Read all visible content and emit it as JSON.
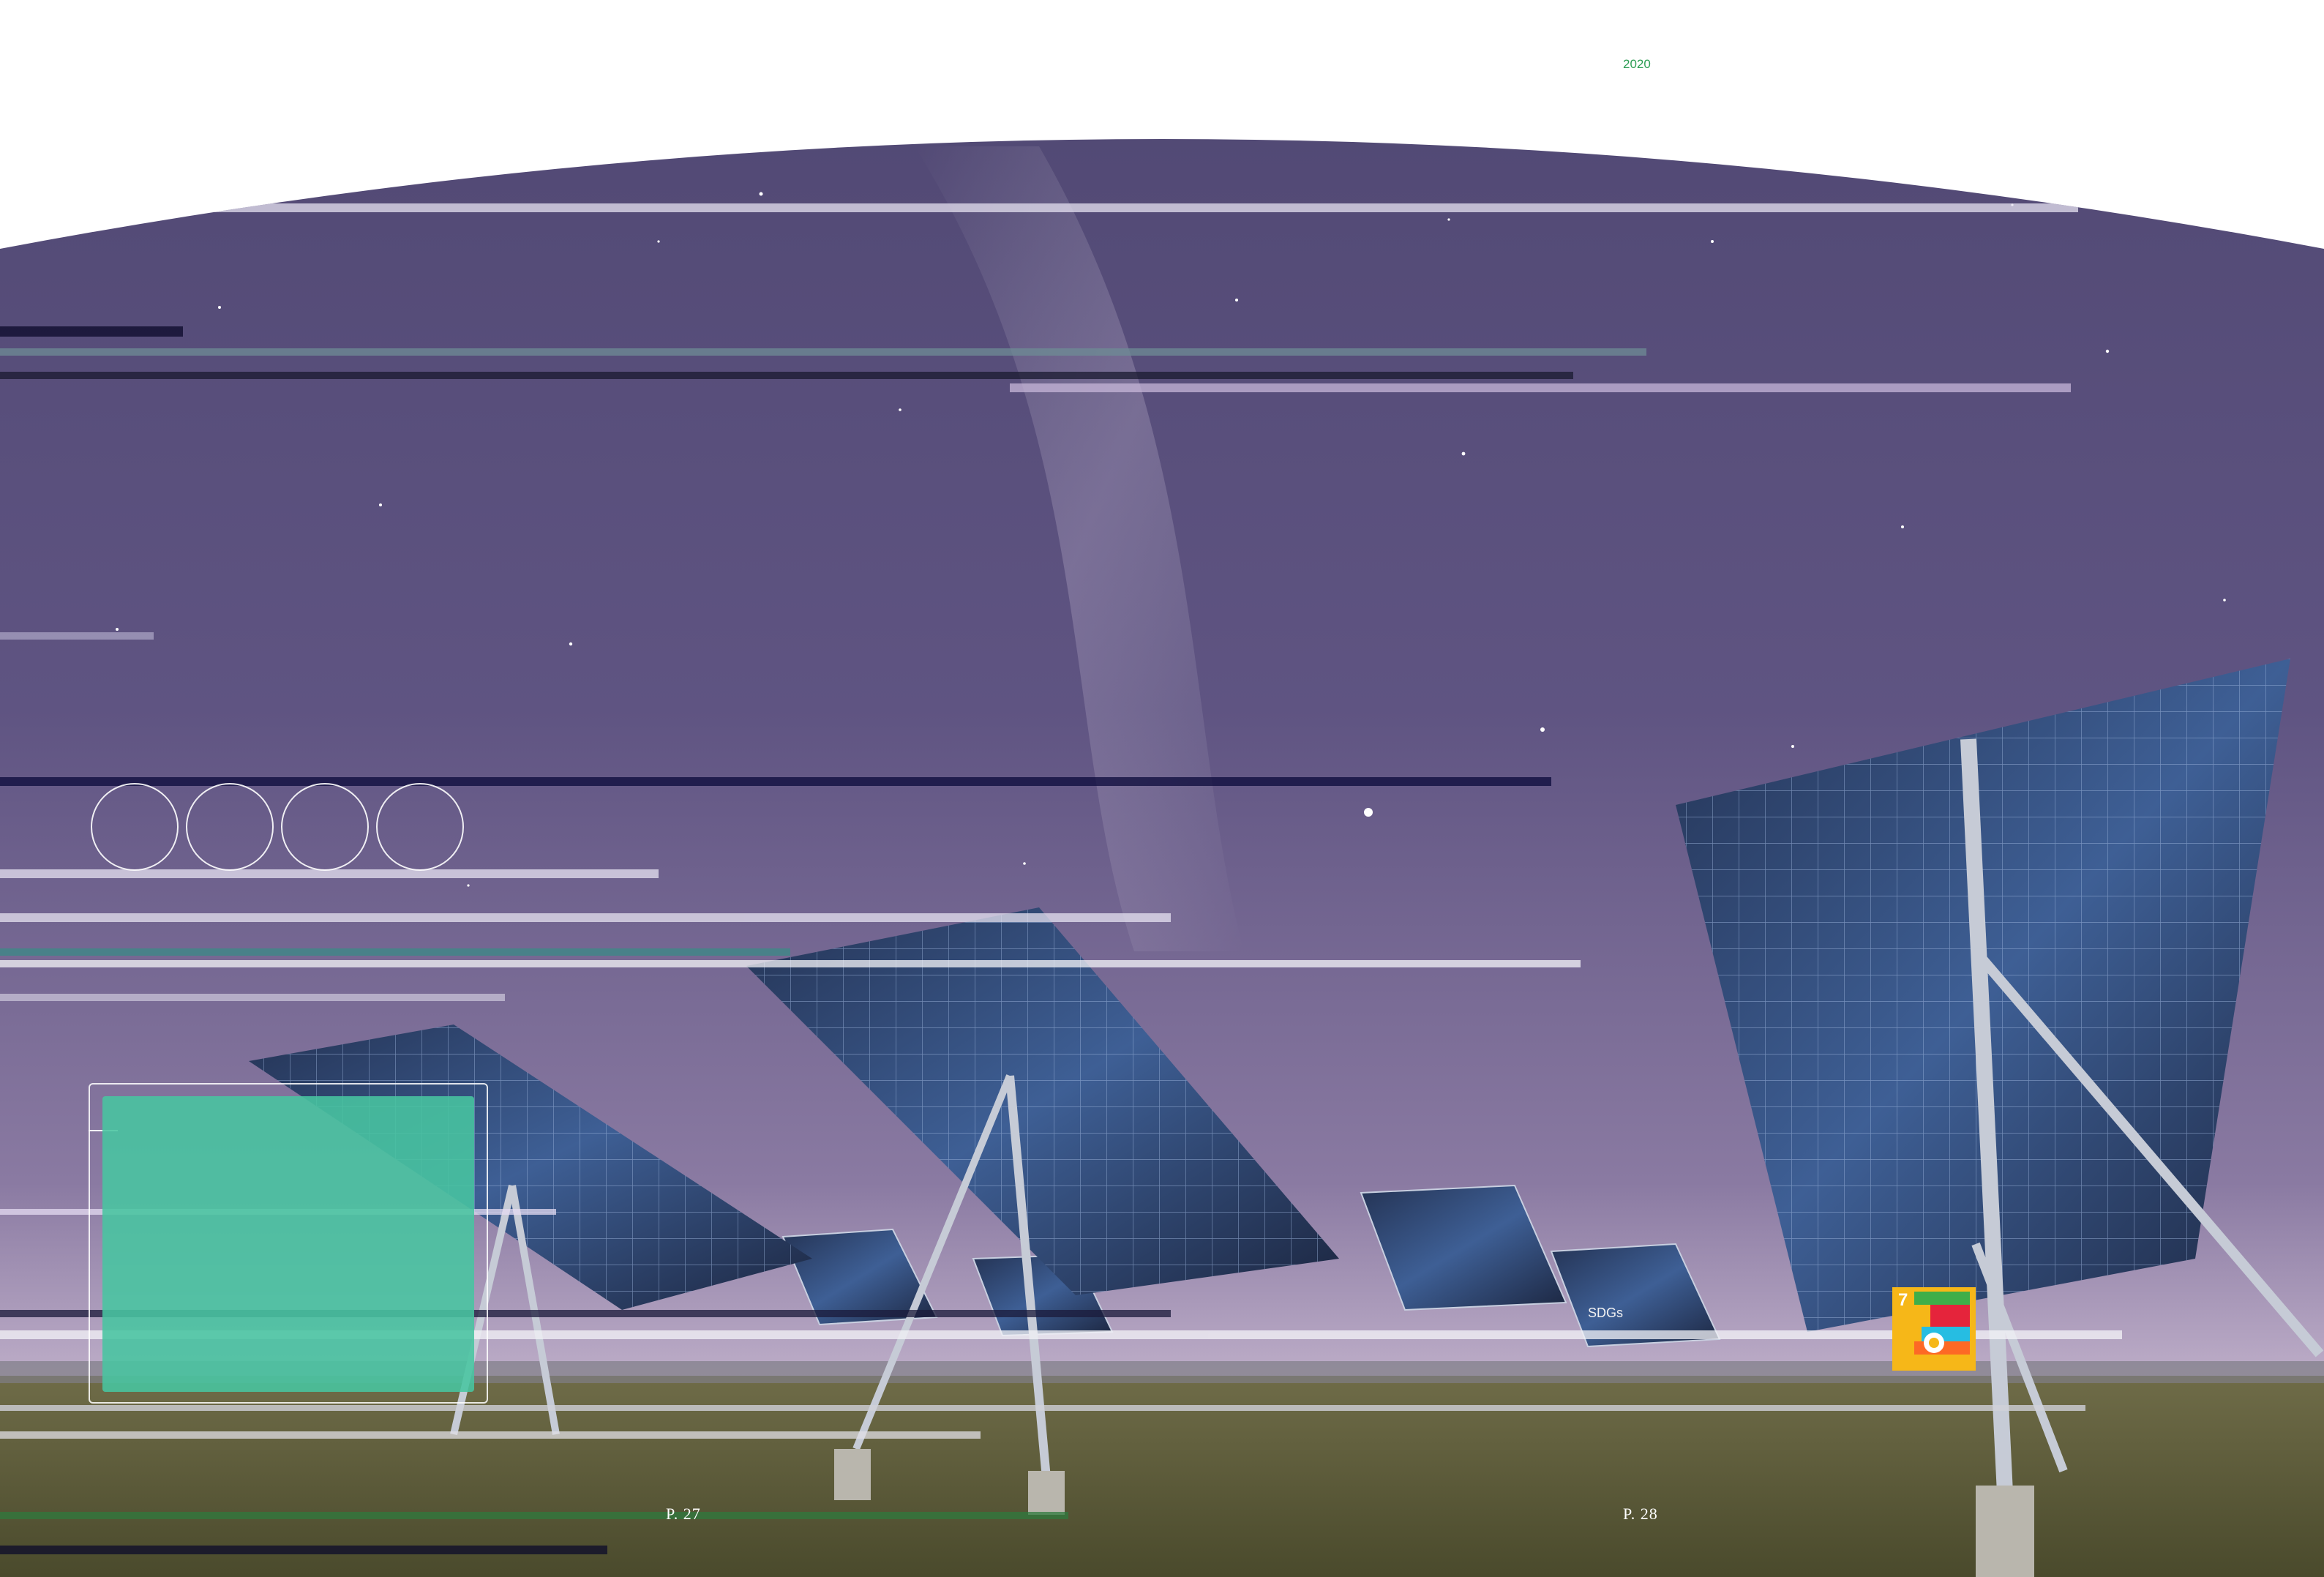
{
  "header": {
    "year": "2020"
  },
  "footer": {
    "page_left": "P. 27",
    "page_right": "P. 28"
  },
  "sdg": {
    "label": "SDGs",
    "goal_number": "7",
    "tile_color": "#f6b718"
  },
  "decor": {
    "icon_circles": [
      "circle-icon",
      "circle-icon",
      "circle-icon",
      "circle-icon"
    ],
    "accent_color": "#48c5a0",
    "sky_color": "#5b4f7f"
  }
}
